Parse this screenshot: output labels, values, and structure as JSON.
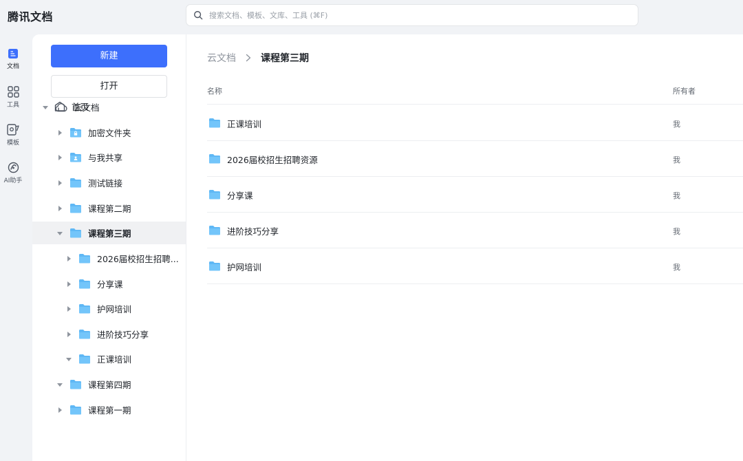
{
  "app": {
    "title": "腾讯文档"
  },
  "search": {
    "placeholder": "搜索文档、模板、文库、工具 (⌘F)"
  },
  "rail": [
    {
      "label": "文档",
      "icon": "document-icon",
      "active": true
    },
    {
      "label": "工具",
      "icon": "grid-icon"
    },
    {
      "label": "模板",
      "icon": "template-icon"
    },
    {
      "label": "AI助手",
      "icon": "ai-assistant-icon"
    }
  ],
  "sidebar": {
    "new_label": "新建",
    "open_label": "打开",
    "tree": [
      {
        "label": "首页",
        "icon": "home-icon",
        "level": 0,
        "arrow": "none"
      },
      {
        "label": "云文档",
        "icon": "cloud-icon",
        "level": 0,
        "arrow": "down"
      },
      {
        "label": "加密文件夹",
        "icon": "locked-folder-icon",
        "level": 1,
        "arrow": "right"
      },
      {
        "label": "与我共享",
        "icon": "shared-folder-icon",
        "level": 1,
        "arrow": "right"
      },
      {
        "label": "测试链接",
        "icon": "folder-icon",
        "level": 1,
        "arrow": "right"
      },
      {
        "label": "课程第二期",
        "icon": "folder-icon",
        "level": 1,
        "arrow": "right"
      },
      {
        "label": "课程第三期",
        "icon": "folder-icon",
        "level": 1,
        "arrow": "down",
        "selected": true
      },
      {
        "label": "2026届校招生招聘...",
        "icon": "folder-icon",
        "level": 2,
        "arrow": "right"
      },
      {
        "label": "分享课",
        "icon": "folder-icon",
        "level": 2,
        "arrow": "right"
      },
      {
        "label": "护网培训",
        "icon": "folder-icon",
        "level": 2,
        "arrow": "right"
      },
      {
        "label": "进阶技巧分享",
        "icon": "folder-icon",
        "level": 2,
        "arrow": "right"
      },
      {
        "label": "正课培训",
        "icon": "folder-icon",
        "level": 2,
        "arrow": "down"
      },
      {
        "label": "课程第四期",
        "icon": "folder-icon",
        "level": 1,
        "arrow": "down"
      },
      {
        "label": "课程第一期",
        "icon": "folder-icon",
        "level": 1,
        "arrow": "right"
      }
    ]
  },
  "breadcrumb": {
    "root": "云文档",
    "current": "课程第三期"
  },
  "table": {
    "col_name": "名称",
    "col_owner": "所有者",
    "rows": [
      {
        "name": "正课培训",
        "owner": "我"
      },
      {
        "name": "2026届校招生招聘资源",
        "owner": "我"
      },
      {
        "name": "分享课",
        "owner": "我"
      },
      {
        "name": "进阶技巧分享",
        "owner": "我"
      },
      {
        "name": "护网培训",
        "owner": "我"
      }
    ]
  },
  "colors": {
    "accent": "#3d6ffc",
    "folder": "#5fb8f5"
  }
}
